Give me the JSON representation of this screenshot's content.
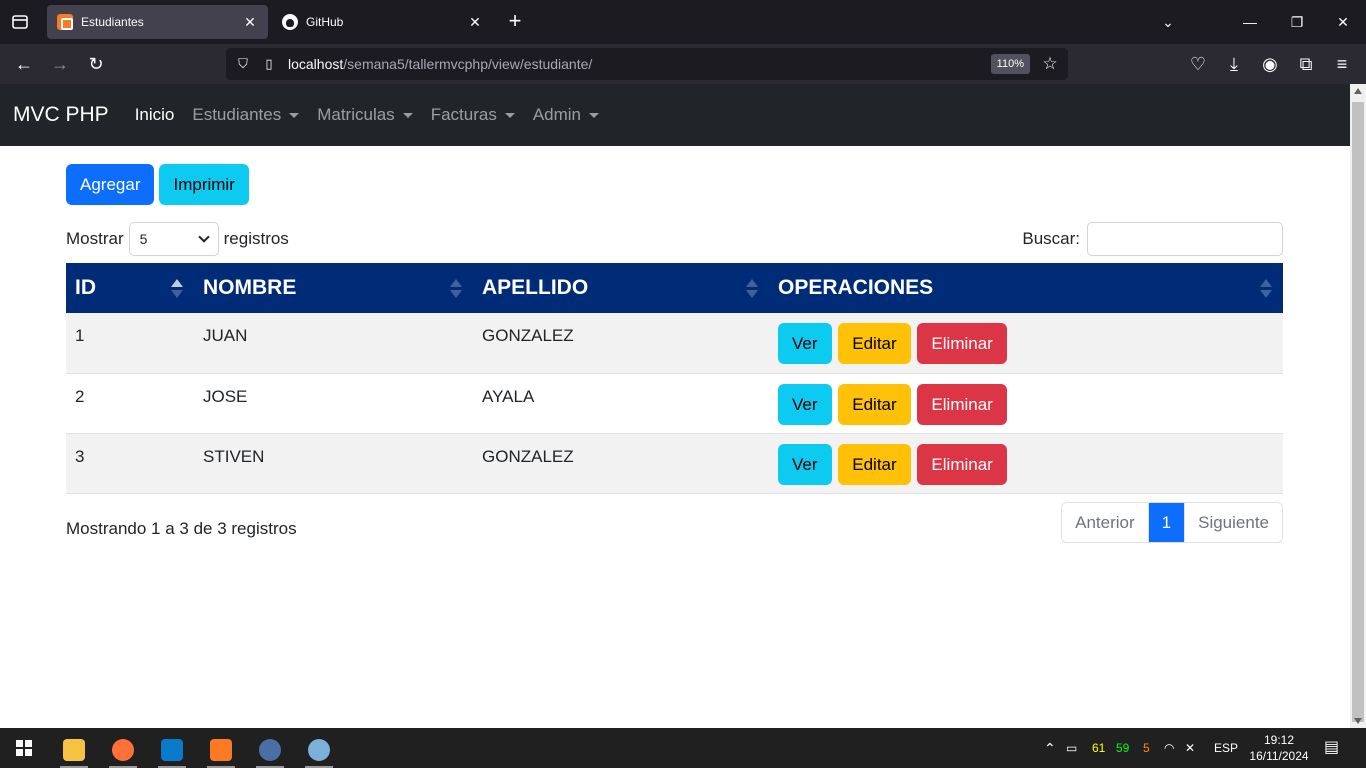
{
  "browser": {
    "tabs": [
      {
        "title": "Estudiantes",
        "active": true
      },
      {
        "title": "GitHub",
        "active": false
      }
    ],
    "url_host": "localhost",
    "url_path": "/semana5/tallermvcphp/view/estudiante/",
    "zoom": "110%"
  },
  "app": {
    "brand": "MVC PHP",
    "nav": [
      {
        "label": "Inicio",
        "dropdown": false
      },
      {
        "label": "Estudiantes",
        "dropdown": true
      },
      {
        "label": "Matriculas",
        "dropdown": true
      },
      {
        "label": "Facturas",
        "dropdown": true
      },
      {
        "label": "Admin",
        "dropdown": true
      }
    ]
  },
  "toolbar": {
    "add_label": "Agregar",
    "print_label": "Imprimir"
  },
  "table_controls": {
    "show_prefix": "Mostrar",
    "show_value": "5",
    "show_suffix": "registros",
    "search_label": "Buscar:",
    "search_value": ""
  },
  "table": {
    "headers": [
      "ID",
      "NOMBRE",
      "APELLIDO",
      "OPERACIONES"
    ],
    "rows": [
      {
        "id": "1",
        "nombre": "JUAN",
        "apellido": "GONZALEZ"
      },
      {
        "id": "2",
        "nombre": "JOSE",
        "apellido": "AYALA"
      },
      {
        "id": "3",
        "nombre": "STIVEN",
        "apellido": "GONZALEZ"
      }
    ],
    "actions": {
      "view": "Ver",
      "edit": "Editar",
      "delete": "Eliminar"
    }
  },
  "footer": {
    "info": "Mostrando 1 a 3 de 3 registros",
    "prev": "Anterior",
    "page": "1",
    "next": "Siguiente"
  },
  "taskbar": {
    "tray_numbers": [
      "61",
      "59",
      "5"
    ],
    "lang": "ESP",
    "time": "19:12",
    "date": "16/11/2024"
  },
  "colors": {
    "navbar": "#212529",
    "table_header": "#002c77",
    "primary": "#0d6efd",
    "info": "#0dcaf0",
    "warning": "#ffc107",
    "danger": "#dc3545"
  }
}
